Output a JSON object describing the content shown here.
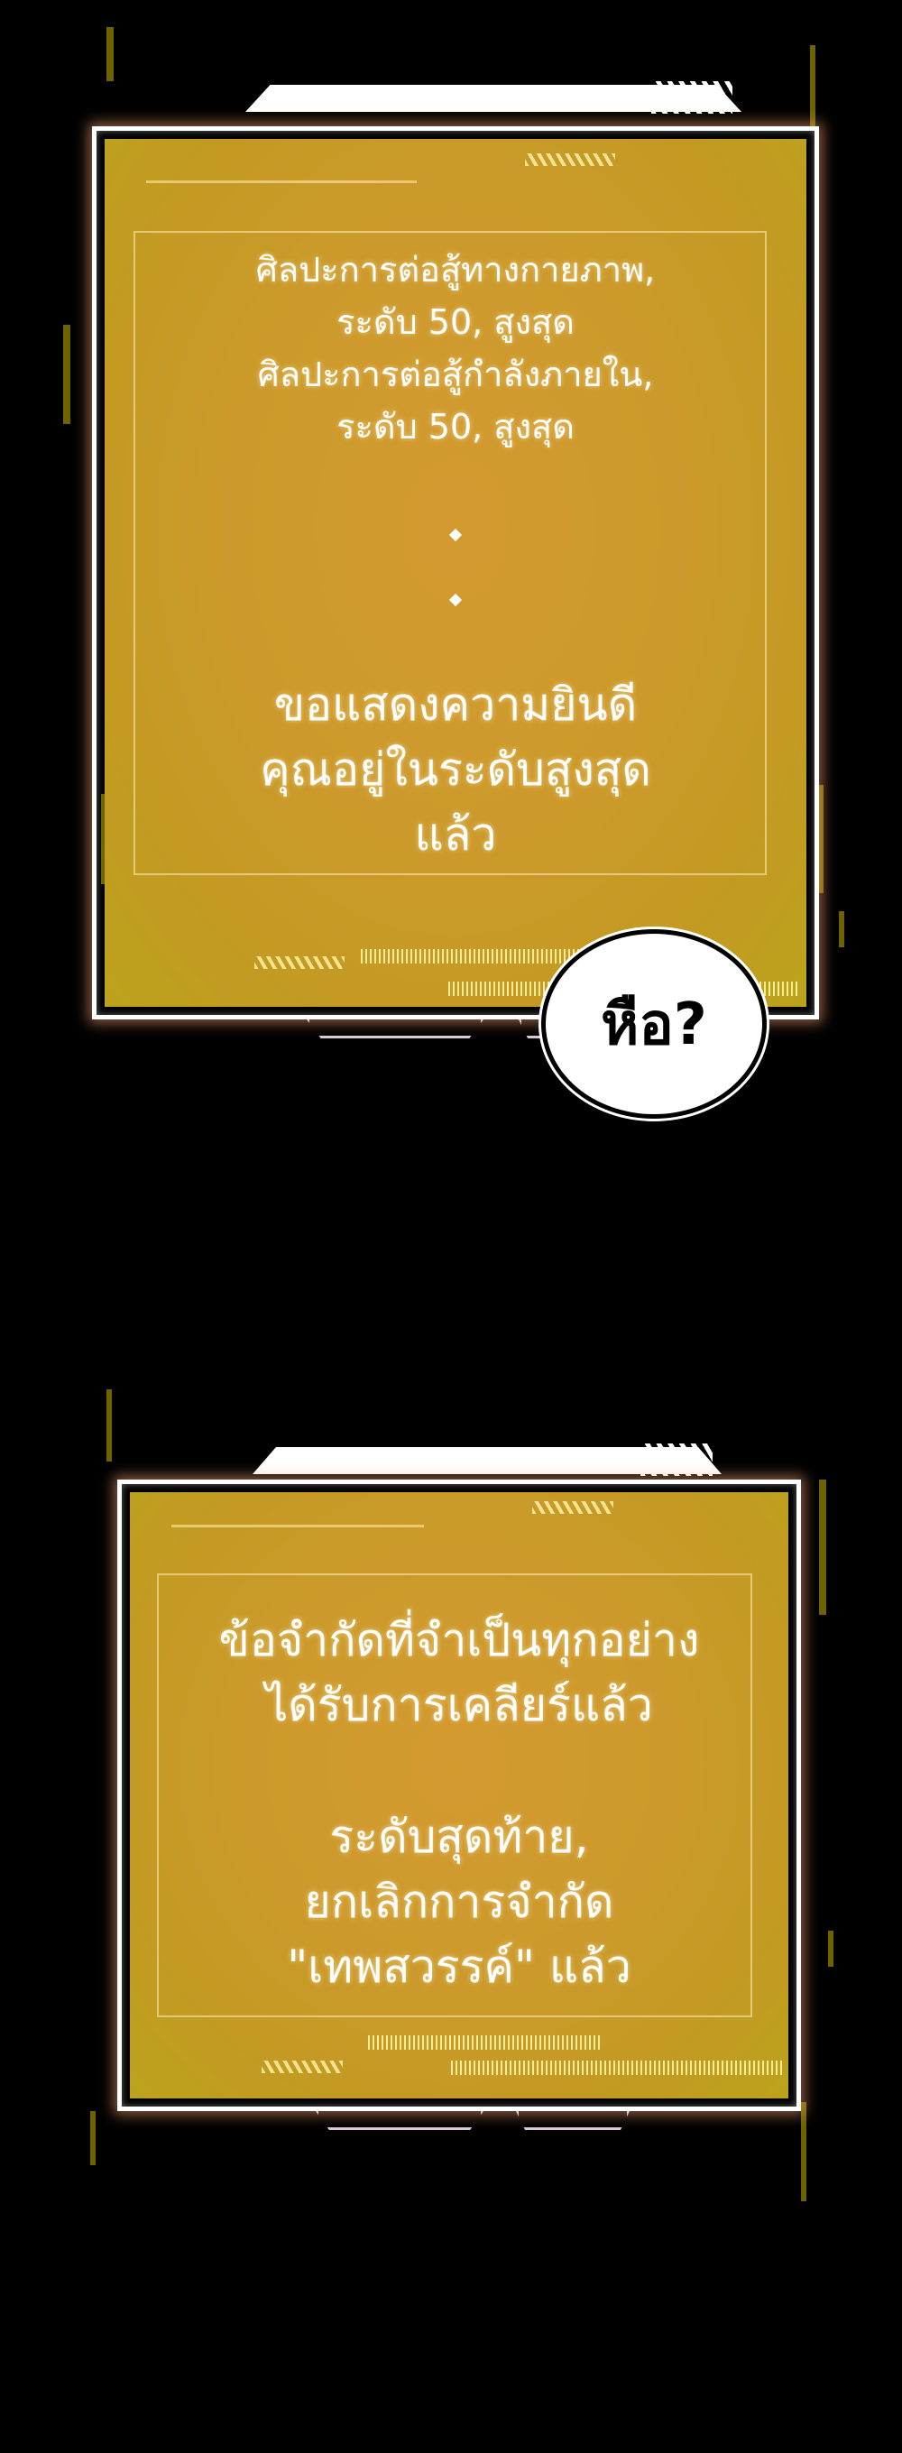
{
  "panel1": {
    "small_lines": [
      "ศิลปะการต่อสู้ทางกายภาพ,",
      "ระดับ 50, สูงสุด",
      "ศิลปะการต่อสู้กำลังภายใน,",
      "ระดับ 50, สูงสุด"
    ],
    "big_lines": [
      "ขอแสดงความยินดี",
      "คุณอยู่ในระดับสูงสุด",
      "แล้ว"
    ]
  },
  "bubble": {
    "text": "หือ?"
  },
  "panel2": {
    "lines_a": [
      "ข้อจำกัดที่จำเป็นทุกอย่าง",
      "ได้รับการเคลียร์แล้ว"
    ],
    "lines_b": [
      "ระดับสุดท้าย,",
      "ยกเลิกการจำกัด",
      "\"เทพสวรรค์\" แล้ว"
    ]
  },
  "colors": {
    "background": "#000000",
    "panel_gold": "#cc9a2c",
    "frame": "#ffffff",
    "glitch": "#c9b400"
  }
}
